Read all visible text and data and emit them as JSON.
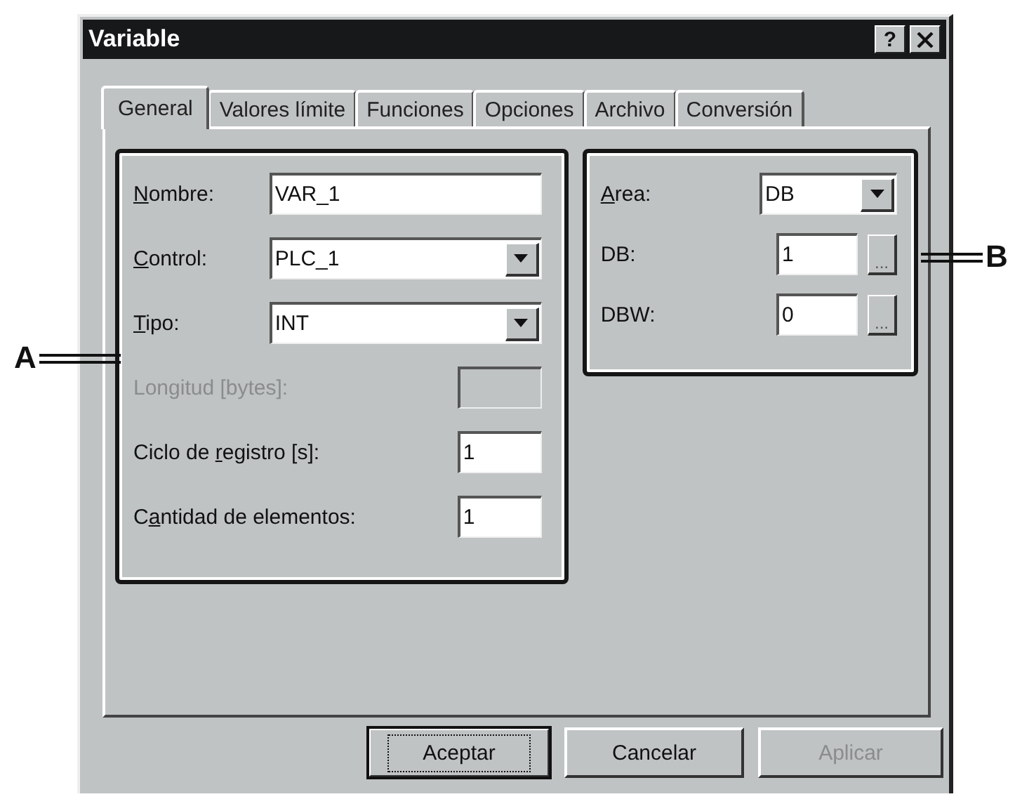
{
  "window": {
    "title": "Variable",
    "help_button": "?"
  },
  "tabs": [
    {
      "label": "General",
      "selected": true
    },
    {
      "label": "Valores límite",
      "selected": false
    },
    {
      "label": "Funciones",
      "selected": false
    },
    {
      "label": "Opciones",
      "selected": false
    },
    {
      "label": "Archivo",
      "selected": false
    },
    {
      "label": "Conversión",
      "selected": false
    }
  ],
  "group_a": {
    "fields": [
      {
        "kind": "text",
        "label_parts": [
          {
            "text": "N",
            "underline": true
          },
          {
            "text": "ombre:",
            "underline": false
          }
        ],
        "value": "VAR_1",
        "disabled": false,
        "wide": true
      },
      {
        "kind": "combo",
        "label_parts": [
          {
            "text": "C",
            "underline": true
          },
          {
            "text": "ontrol:",
            "underline": false
          }
        ],
        "value": "PLC_1",
        "disabled": false,
        "wide": true
      },
      {
        "kind": "combo",
        "label_parts": [
          {
            "text": "T",
            "underline": true
          },
          {
            "text": "ipo:",
            "underline": false
          }
        ],
        "value": "INT",
        "disabled": false,
        "wide": true
      },
      {
        "kind": "text",
        "label_parts": [
          {
            "text": "Longitud [bytes]:",
            "underline": false
          }
        ],
        "disabled": true,
        "wide": false
      },
      {
        "kind": "text",
        "label_parts": [
          {
            "text": "Ciclo de ",
            "underline": false
          },
          {
            "text": "r",
            "underline": true
          },
          {
            "text": "egistro [s]:",
            "underline": false
          }
        ],
        "value": "1",
        "disabled": false,
        "wide": false
      },
      {
        "kind": "text",
        "label_parts": [
          {
            "text": "C",
            "underline": false
          },
          {
            "text": "a",
            "underline": true
          },
          {
            "text": "ntidad de elementos:",
            "underline": false
          }
        ],
        "value": "1",
        "disabled": false,
        "wide": false
      }
    ]
  },
  "group_b": {
    "fields": [
      {
        "kind": "combo",
        "label_parts": [
          {
            "text": "A",
            "underline": true
          },
          {
            "text": "rea:",
            "underline": false
          }
        ],
        "value": "DB"
      },
      {
        "kind": "browse",
        "label_parts": [
          {
            "text": "DB:",
            "underline": false
          }
        ],
        "value": "1",
        "browse_button": "..."
      },
      {
        "kind": "browse",
        "label_parts": [
          {
            "text": "DBW:",
            "underline": false
          }
        ],
        "value": "0",
        "browse_button": "..."
      }
    ]
  },
  "buttons": [
    {
      "label": "Aceptar",
      "default": true,
      "disabled": false
    },
    {
      "label": "Cancelar",
      "default": false,
      "disabled": false
    },
    {
      "label": "Aplicar",
      "default": false,
      "disabled": true
    }
  ],
  "callouts": [
    {
      "label": "A"
    },
    {
      "label": "B"
    }
  ]
}
